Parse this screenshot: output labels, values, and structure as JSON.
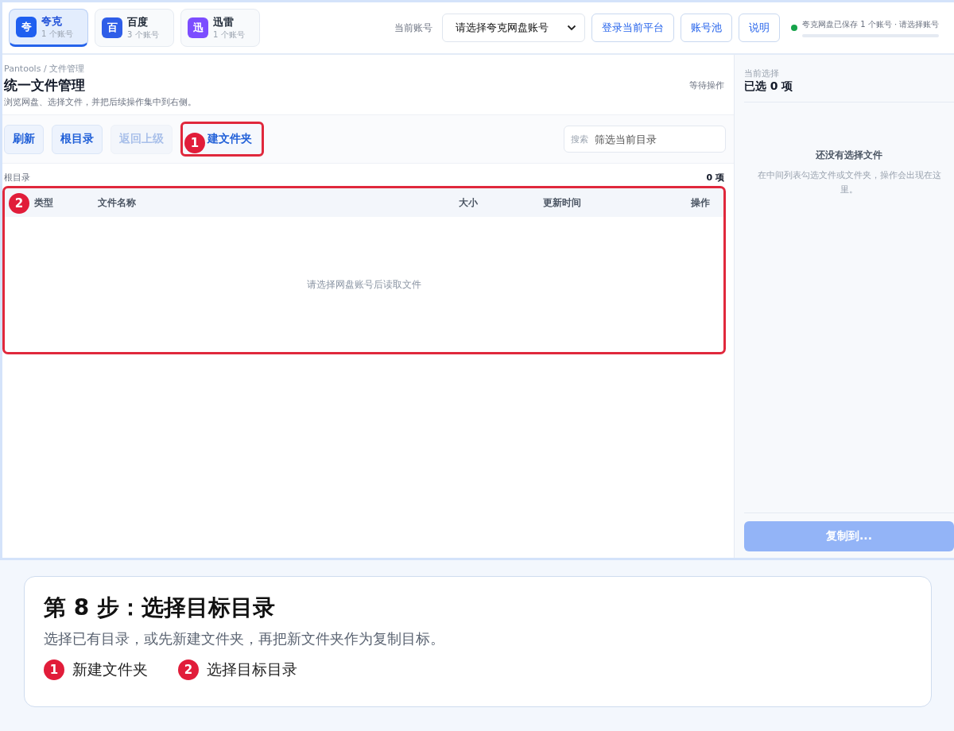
{
  "platforms": [
    {
      "icon": "夸",
      "name": "夸克",
      "count": "1 个账号",
      "selected": true,
      "color": "#1f5ff0"
    },
    {
      "icon": "百",
      "name": "百度",
      "count": "3 个账号",
      "selected": false,
      "color": "#2f5ee8"
    },
    {
      "icon": "迅",
      "name": "迅雷",
      "count": "1 个账号",
      "selected": false,
      "color": "#7c4dff"
    }
  ],
  "account": {
    "label": "当前账号",
    "value": "请选择夸克网盘账号"
  },
  "top_buttons": [
    "登录当前平台",
    "账号池",
    "说明"
  ],
  "status": {
    "text": "夸克网盘已保存 1 个账号 · 请选择账号",
    "online": true,
    "level": 0
  },
  "header": {
    "breadcrumb": "Pantools / 文件管理",
    "title": "统一文件管理",
    "subtitle": "浏览网盘、选择文件，并把后续操作集中到右侧。",
    "state": "等待操作"
  },
  "toolbar": {
    "buttons": [
      {
        "label": "刷新",
        "disabled": false
      },
      {
        "label": "根目录",
        "disabled": false
      },
      {
        "label": "返回上级",
        "disabled": true
      },
      {
        "label": "建文件夹",
        "disabled": false,
        "callout": "1"
      }
    ],
    "search": {
      "label": "搜索",
      "placeholder": "筛选当前目录"
    }
  },
  "path": {
    "current": "根目录",
    "count": "0 项"
  },
  "table": {
    "callout": "2",
    "columns": [
      "类型",
      "文件名称",
      "大小",
      "更新时间",
      "操作"
    ],
    "empty": "请选择网盘账号后读取文件"
  },
  "selection": {
    "label": "当前选择",
    "count": "已选 0 项",
    "empty_title": "还没有选择文件",
    "empty_text": "在中间列表勾选文件或文件夹，操作会出现在这里。",
    "button": {
      "label": "复制到...",
      "disabled": true
    }
  },
  "caption": {
    "title": "第 8 步：选择目标目录",
    "text": "选择已有目录，或先新建文件夹，再把新文件夹作为复制目标。",
    "legend": [
      {
        "number": "1",
        "label": "新建文件夹"
      },
      {
        "number": "2",
        "label": "选择目标目录"
      }
    ]
  }
}
